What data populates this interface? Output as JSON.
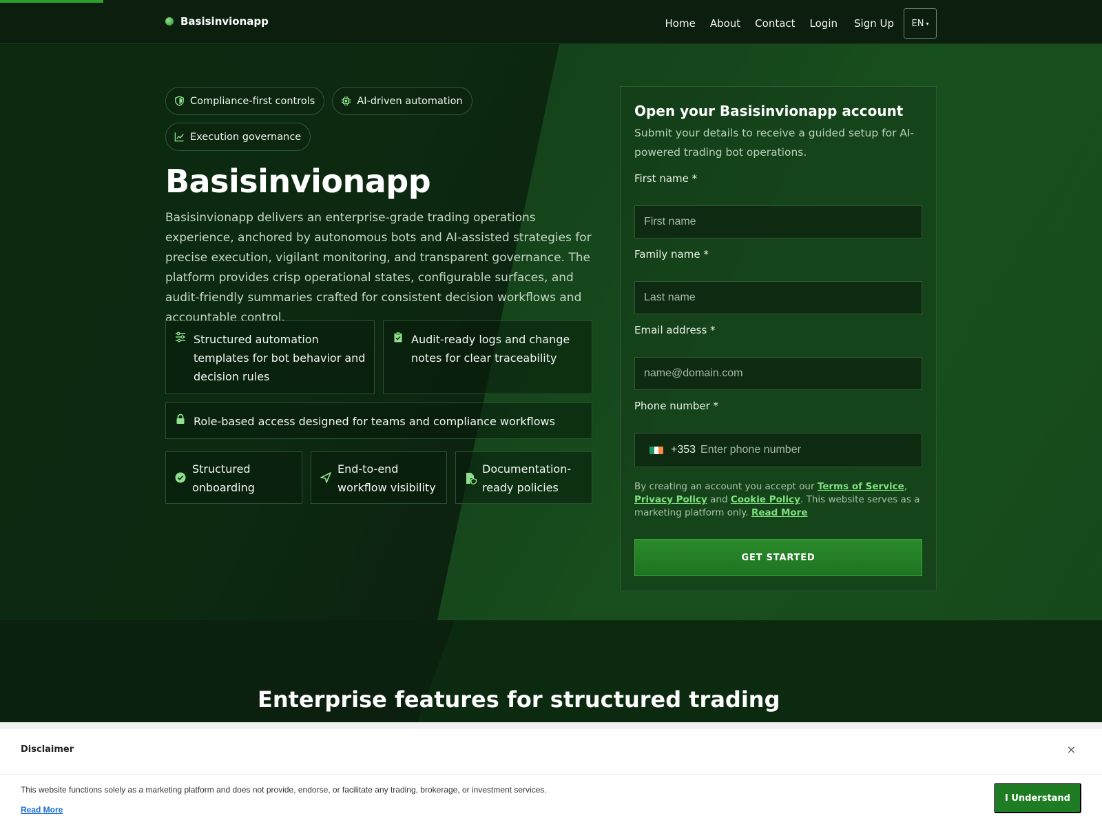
{
  "brand": {
    "name": "Basisinvionapp"
  },
  "nav": {
    "items": [
      "Home",
      "About",
      "Contact",
      "Login",
      "Sign Up"
    ],
    "lang": "EN",
    "lang_caret": "▾"
  },
  "hero": {
    "chips": [
      "Compliance-first controls",
      "AI-driven automation",
      "Execution governance"
    ],
    "title": "Basisinvionapp",
    "description": "Basisinvionapp delivers an enterprise-grade trading operations experience, anchored by autonomous bots and AI-assisted strategies for precise execution, vigilant monitoring, and transparent governance. The platform provides crisp operational states, configurable surfaces, and audit-friendly summaries crafted for consistent decision workflows and accountable control.",
    "features": [
      "Structured automation templates for bot behavior and decision rules",
      "Audit-ready logs and change notes for clear traceability",
      "Role-based access designed for teams and compliance workflows",
      "Structured onboarding",
      "End-to-end workflow visibility",
      "Documentation-ready policies"
    ]
  },
  "form": {
    "title": "Open your Basisinvionapp account",
    "subtitle": "Submit your details to receive a guided setup for AI-powered trading bot operations.",
    "first_name_label": "First name *",
    "first_name_placeholder": "First name",
    "last_name_label": "Family name *",
    "last_name_placeholder": "Last name",
    "email_label": "Email address *",
    "email_placeholder": "name@domain.com",
    "phone_label": "Phone number *",
    "phone_dial": "+353",
    "phone_placeholder": "Enter phone number",
    "legal_prefix": "By creating an account you accept our",
    "terms": "Terms of Service",
    "comma": ",",
    "privacy": "Privacy Policy",
    "and": "and",
    "cookie": "Cookie Policy",
    "legal_suffix": ". This website serves as a marketing platform only.",
    "read_more": "Read More",
    "submit": "GET STARTED"
  },
  "section": {
    "title": "Enterprise features for structured trading"
  },
  "disclaimer": {
    "title": "Disclaimer",
    "close": "×",
    "text": "This website functions solely as a marketing platform and does not provide, endorse, or facilitate any trading, brokerage, or investment services.",
    "read_more": "Read More",
    "button": "I Understand"
  },
  "colors": {
    "accent": "#2aa02a",
    "link": "#7fe07f",
    "button": "#1e7d22"
  },
  "icons": [
    "shield-icon",
    "chip-icon",
    "chart-icon",
    "sliders-icon",
    "clipboard-check-icon",
    "lock-icon",
    "check-circle-icon",
    "send-icon",
    "file-shield-icon",
    "ireland-flag-icon"
  ]
}
